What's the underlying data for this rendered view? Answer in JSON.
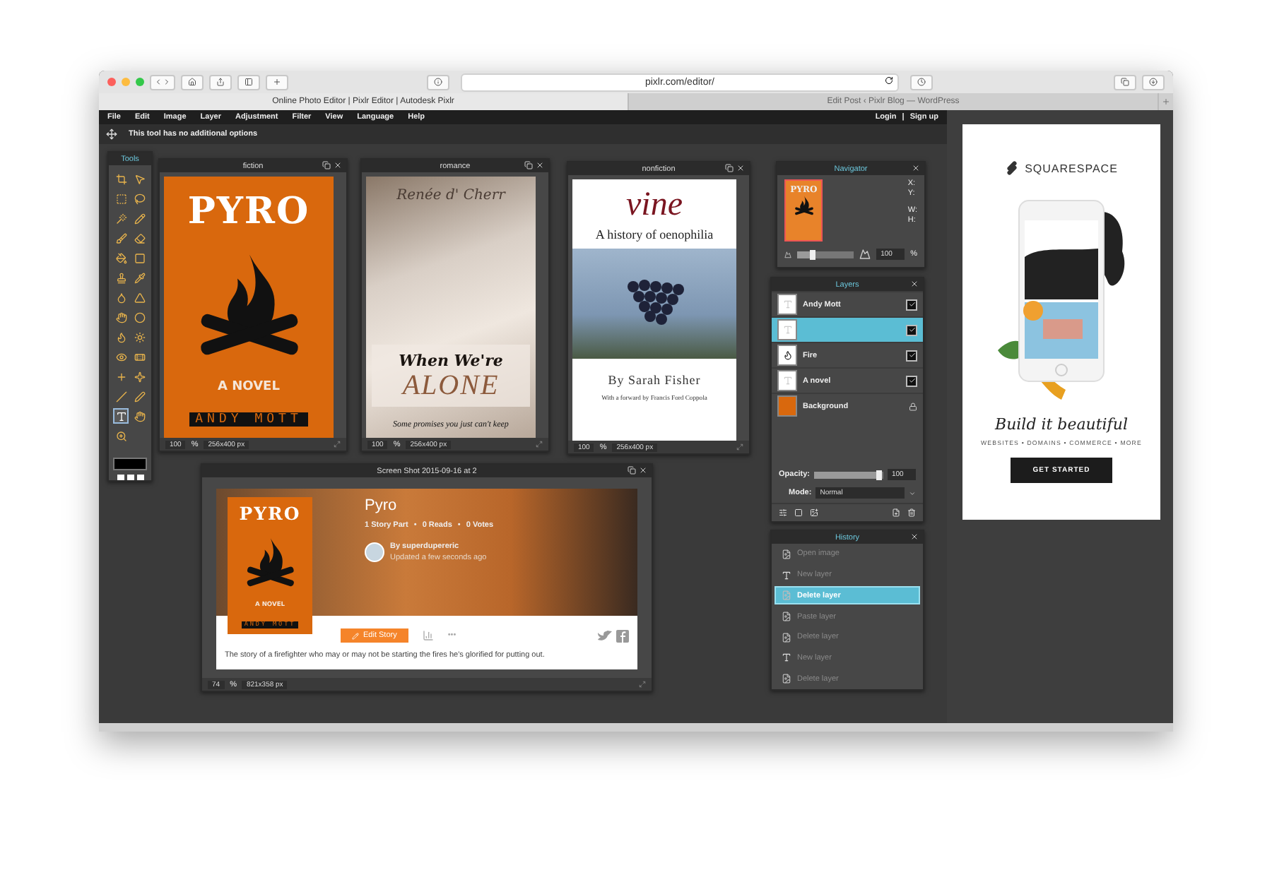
{
  "browser": {
    "url": "pixlr.com/editor/",
    "tabs": [
      {
        "label": "Online Photo Editor | Pixlr Editor | Autodesk Pixlr",
        "selected": true
      },
      {
        "label": "Edit Post ‹ Pixlr Blog — WordPress",
        "selected": false
      }
    ]
  },
  "menu": {
    "items": [
      "File",
      "Edit",
      "Image",
      "Layer",
      "Adjustment",
      "Filter",
      "View",
      "Language",
      "Help"
    ],
    "login": "Login",
    "separator": "|",
    "signup": "Sign up"
  },
  "options_bar": {
    "text": "This tool has no additional options"
  },
  "tools": {
    "title": "Tools",
    "items": [
      {
        "selected": false
      },
      {
        "selected": false
      },
      {
        "selected": false
      },
      {
        "selected": false
      },
      {
        "selected": false
      },
      {
        "selected": false
      },
      {
        "selected": false
      },
      {
        "selected": false
      },
      {
        "selected": false
      },
      {
        "selected": false
      },
      {
        "selected": false
      },
      {
        "selected": false
      },
      {
        "selected": false
      },
      {
        "selected": false
      },
      {
        "selected": false
      },
      {
        "selected": false
      },
      {
        "selected": false
      },
      {
        "selected": false
      },
      {
        "selected": false
      },
      {
        "selected": false
      },
      {
        "selected": false
      },
      {
        "selected": false
      },
      {
        "selected": false
      },
      {
        "selected": false
      },
      {
        "selected": true
      },
      {
        "selected": false
      },
      {
        "selected": false
      }
    ]
  },
  "documents": [
    {
      "title": "fiction",
      "zoom": "100",
      "percent": "%",
      "size": "256x400 px",
      "cover": {
        "kind": "pyro",
        "title": "PYRO",
        "subtitle": "A NOVEL",
        "author": "ANDY MOTT"
      }
    },
    {
      "title": "romance",
      "zoom": "100",
      "percent": "%",
      "size": "256x400 px",
      "cover": {
        "kind": "romance",
        "author": "Renée d' Cherr",
        "title": "When We're",
        "title_2": "ALONE",
        "tagline": "Some promises you just can't keep"
      }
    },
    {
      "title": "nonfiction",
      "zoom": "100",
      "percent": "%",
      "size": "256x400 px",
      "cover": {
        "kind": "nonfiction",
        "title": "vine",
        "subtitle": "A history of oenophilia",
        "author": "By Sarah Fisher",
        "foreword": "With a forward by Francis Ford Coppola"
      }
    }
  ],
  "navigator": {
    "title": "Navigator",
    "thumbnail_title": "PYRO",
    "x_label": "X:",
    "y_label": "Y:",
    "w_label": "W:",
    "h_label": "H:",
    "zoom": {
      "level": 0.28,
      "value": "100",
      "percent": "%"
    }
  },
  "layers": {
    "title": "Layers",
    "items": [
      {
        "name": "Andy Mott",
        "kind": "text",
        "selected": false,
        "locked": false,
        "visible": true
      },
      {
        "kind": "text",
        "selected": true,
        "locked": false,
        "visible": true
      },
      {
        "name": "Fire",
        "kind": "image",
        "selected": false,
        "locked": false,
        "visible": true
      },
      {
        "name": "A novel",
        "kind": "text",
        "selected": false,
        "locked": false,
        "visible": true
      },
      {
        "name": "Background",
        "kind": "fill",
        "selected": false,
        "locked": true
      }
    ],
    "opacity_label": "Opacity:",
    "opacity": {
      "level": 0.93,
      "value": "100"
    },
    "mode_label": "Mode:",
    "mode": "Normal"
  },
  "history": {
    "title": "History",
    "items": [
      {
        "label": "Open image",
        "kind": "image",
        "selected": false
      },
      {
        "label": "New layer",
        "kind": "text",
        "selected": false
      },
      {
        "label": "Delete layer",
        "kind": "image",
        "selected": true
      },
      {
        "label": "Paste layer",
        "kind": "image",
        "selected": false
      },
      {
        "label": "Delete layer",
        "kind": "image",
        "selected": false
      },
      {
        "label": "New layer",
        "kind": "text",
        "selected": false
      },
      {
        "label": "Delete layer",
        "kind": "image",
        "selected": false
      }
    ]
  },
  "screenshot": {
    "title": "Screen Shot 2015-09-16 at 2",
    "zoom": "74",
    "percent": "%",
    "size": "821x358 px",
    "cover": {
      "kind": "pyro",
      "title": "PYRO",
      "subtitle": "A NOVEL",
      "author": "ANDY MOTT"
    },
    "story": {
      "title": "Pyro",
      "stats": [
        "1 Story Part",
        "0 Reads",
        "0 Votes"
      ],
      "bullet": "•",
      "author": "By superdupereric",
      "updated": "Updated a few seconds ago",
      "button": "Edit Story",
      "more": "•••",
      "description": "The story of a firefighter who may or may not be starting the fires he's glorified for putting out."
    }
  },
  "ad": {
    "brand": "SQUARESPACE",
    "script": "Build it beautiful",
    "tagline": "WEBSITES • DOMAINS • COMMERCE • MORE",
    "button": "GET STARTED"
  }
}
